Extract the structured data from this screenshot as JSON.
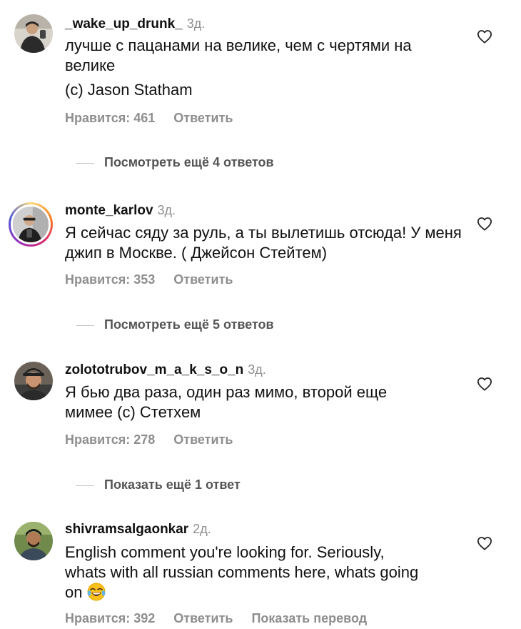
{
  "comments": [
    {
      "username": "_wake_up_drunk_",
      "time": "3д.",
      "lines": [
        "лучше с пацанами на велике, чем с чертями на велике",
        "(c) Jason Statham"
      ],
      "likes": "Нравится: 461",
      "reply": "Ответить",
      "avatar_icon": "person-avatar"
    },
    {
      "username": "monte_karlov",
      "time": "3д.",
      "lines": [
        "Я сейчас сяду за руль, а ты вылетишь отсюда! У меня джип в Москве. ( Джейсон Стейтем)"
      ],
      "likes": "Нравится: 353",
      "reply": "Ответить",
      "avatar_icon": "person-avatar-story-ring"
    },
    {
      "username": "zolototrubov_m_a_k_s_o_n",
      "time": "3д.",
      "lines": [
        "Я бью два раза, один раз мимо, второй еще мимее (с) Стетхем"
      ],
      "likes": "Нравится: 278",
      "reply": "Ответить",
      "avatar_icon": "person-avatar"
    },
    {
      "username": "shivramsalgaonkar",
      "time": "2д.",
      "lines": [
        "English comment you're looking for. Seriously, whats with all russian comments here, whats going on"
      ],
      "emoji": "face-with-tears-of-joy",
      "likes": "Нравится: 392",
      "reply": "Ответить",
      "translate": "Показать перевод",
      "avatar_icon": "person-avatar"
    }
  ],
  "view_replies": [
    "Посмотреть ещё 4 ответов",
    "Посмотреть ещё 5 ответов",
    "Показать ещё 1 ответ"
  ],
  "colors": {
    "text": "#111111",
    "secondary": "#8e8e8e",
    "divider": "#c7c7c7"
  },
  "icons": {
    "like": "heart-outline-icon"
  }
}
